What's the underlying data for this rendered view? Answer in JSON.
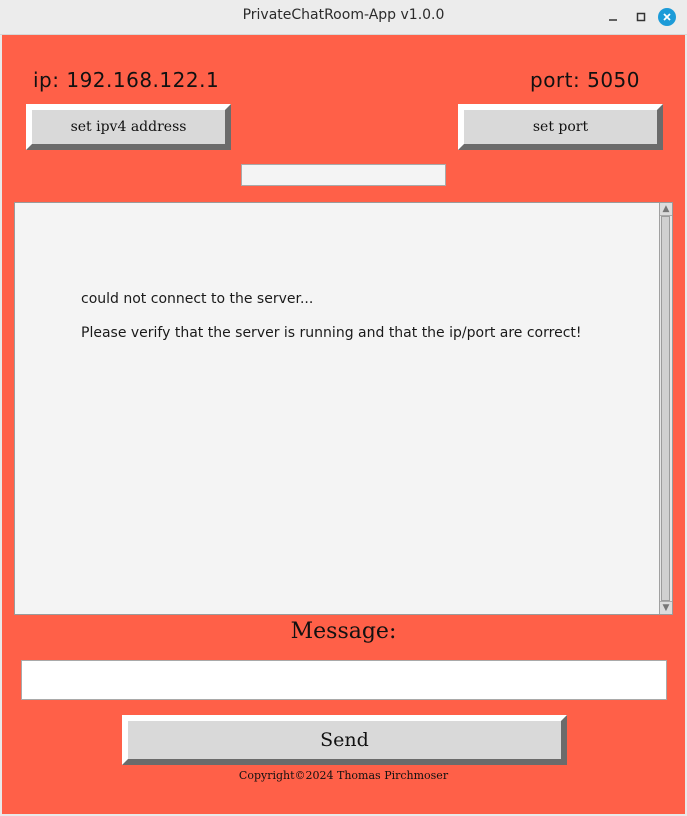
{
  "window": {
    "title": "PrivateChatRoom-App v1.0.0",
    "close_color": "#1c9bd8"
  },
  "theme": {
    "background": "#ff6048",
    "button_face": "#d9d9d9",
    "text_area": "#f4f4f4"
  },
  "connection": {
    "ip_text": "ip: 192.168.122.1",
    "port_text": "port: 5050",
    "set_ip_label": "set ipv4 address",
    "set_port_label": "set port",
    "entry_value": ""
  },
  "chat": {
    "lines": [
      "could not connect to the server...",
      "Please verify that the server is running and that the ip/port are correct!"
    ]
  },
  "composer": {
    "label": "Message:",
    "value": "",
    "send_label": "Send"
  },
  "footer": {
    "copyright": "Copyright©2024 Thomas Pirchmoser"
  },
  "icons": [
    "minimize-icon",
    "maximize-icon",
    "close-icon",
    "scroll-up-arrow-icon",
    "scroll-down-arrow-icon"
  ]
}
